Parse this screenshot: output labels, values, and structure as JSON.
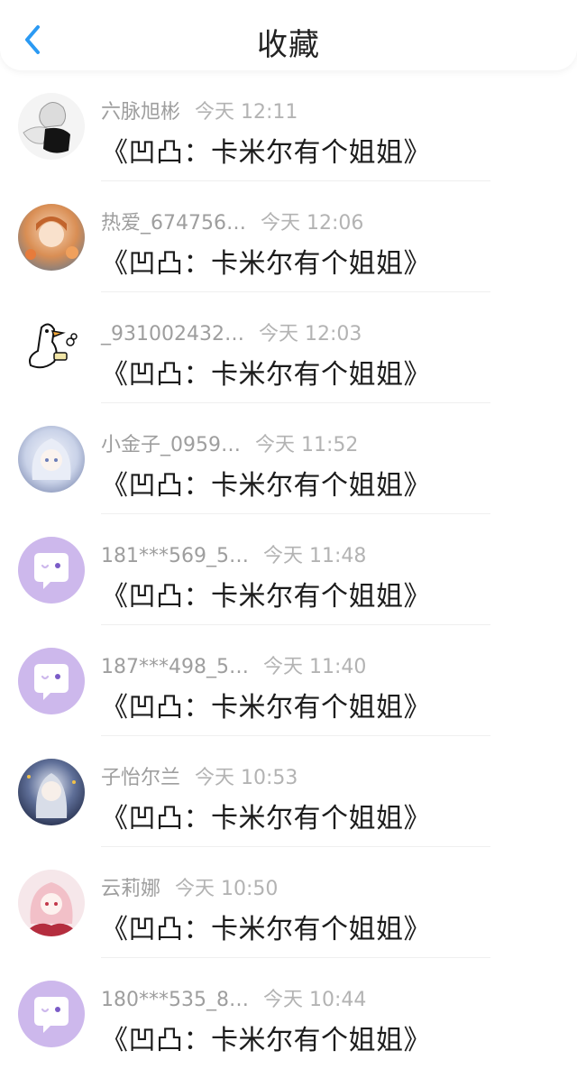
{
  "header": {
    "title": "收藏",
    "back_icon": "chevron-left-icon",
    "accent_color": "#2b9af3"
  },
  "favorites": [
    {
      "username": "六脉旭彬",
      "time": "今天 12:11",
      "content": "《凹凸：卡米尔有个姐姐》",
      "avatar": "sketch-girl-avatar"
    },
    {
      "username": "热爱_674756…",
      "time": "今天 12:06",
      "content": "《凹凸：卡米尔有个姐姐》",
      "avatar": "autumn-girl-avatar"
    },
    {
      "username": "_931002432…",
      "time": "今天 12:03",
      "content": "《凹凸：卡米尔有个姐姐》",
      "avatar": "goose-avatar"
    },
    {
      "username": "小金子_0959…",
      "time": "今天 11:52",
      "content": "《凹凸：卡米尔有个姐姐》",
      "avatar": "white-hair-girl-avatar"
    },
    {
      "username": "181***569_5…",
      "time": "今天 11:48",
      "content": "《凹凸：卡米尔有个姐姐》",
      "avatar": "default-chat-avatar"
    },
    {
      "username": "187***498_5…",
      "time": "今天 11:40",
      "content": "《凹凸：卡米尔有个姐姐》",
      "avatar": "default-chat-avatar"
    },
    {
      "username": "子怡尔兰",
      "time": "今天 10:53",
      "content": "《凹凸：卡米尔有个姐姐》",
      "avatar": "night-girl-avatar"
    },
    {
      "username": "云莉娜",
      "time": "今天 10:50",
      "content": "《凹凸：卡米尔有个姐姐》",
      "avatar": "pink-hair-girl-avatar"
    },
    {
      "username": "180***535_8…",
      "time": "今天 10:44",
      "content": "《凹凸：卡米尔有个姐姐》",
      "avatar": "default-chat-avatar"
    }
  ]
}
